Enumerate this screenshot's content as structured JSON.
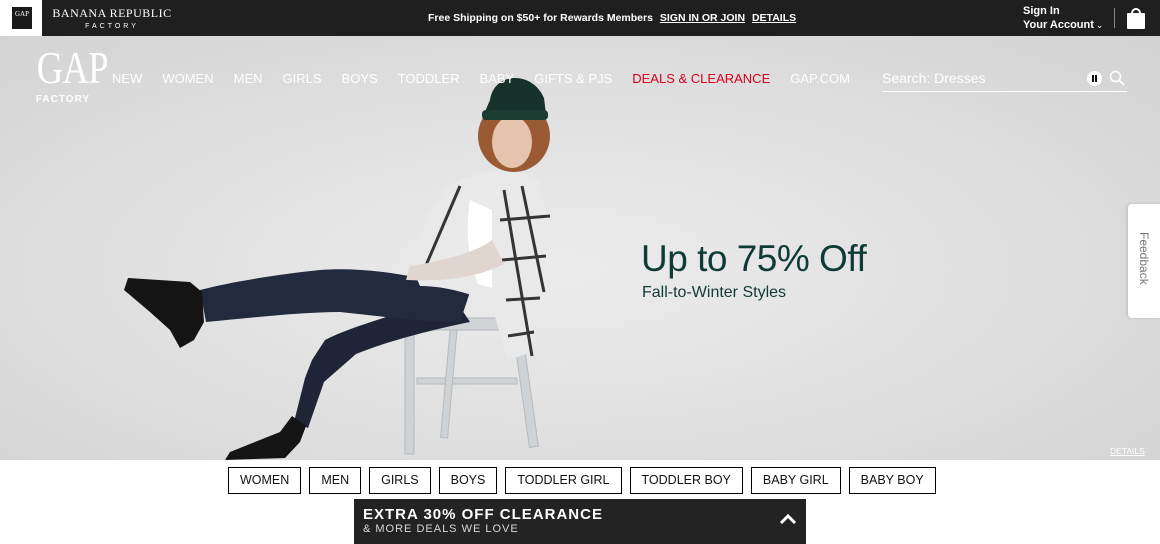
{
  "topbar": {
    "gap_mini_logo": "GAP",
    "br_logo_line1": "BANANA REPUBLIC",
    "br_logo_line2": "FACTORY",
    "promo_text": "Free Shipping on $50+ for Rewards Members",
    "signin_link": "SIGN IN OR JOIN",
    "details_link": "DETAILS",
    "sign_in": "Sign In",
    "your_account": "Your Account",
    "bag_icon": "shopping-bag-icon"
  },
  "header": {
    "logo_big": "GAP",
    "logo_small": "FACTORY",
    "nav": [
      "NEW",
      "WOMEN",
      "MEN",
      "GIRLS",
      "BOYS",
      "TODDLER",
      "BABY",
      "GIFTS & PJS",
      "DEALS & CLEARANCE",
      "GAP.COM"
    ],
    "search_placeholder": "Search: Dresses",
    "deals_color": "#d6001c"
  },
  "hero": {
    "headline": "Up to 75% Off",
    "subline": "Fall-to-Winter Styles",
    "details": "DETAILS",
    "headline_color": "#0f3b36"
  },
  "feedback_tab": "Feedback",
  "categories": [
    "WOMEN",
    "MEN",
    "GIRLS",
    "BOYS",
    "TODDLER GIRL",
    "TODDLER BOY",
    "BABY GIRL",
    "BABY BOY"
  ],
  "promo_banner": {
    "title": "EXTRA 30% OFF CLEARANCE",
    "subtitle": "& MORE DEALS WE LOVE"
  }
}
